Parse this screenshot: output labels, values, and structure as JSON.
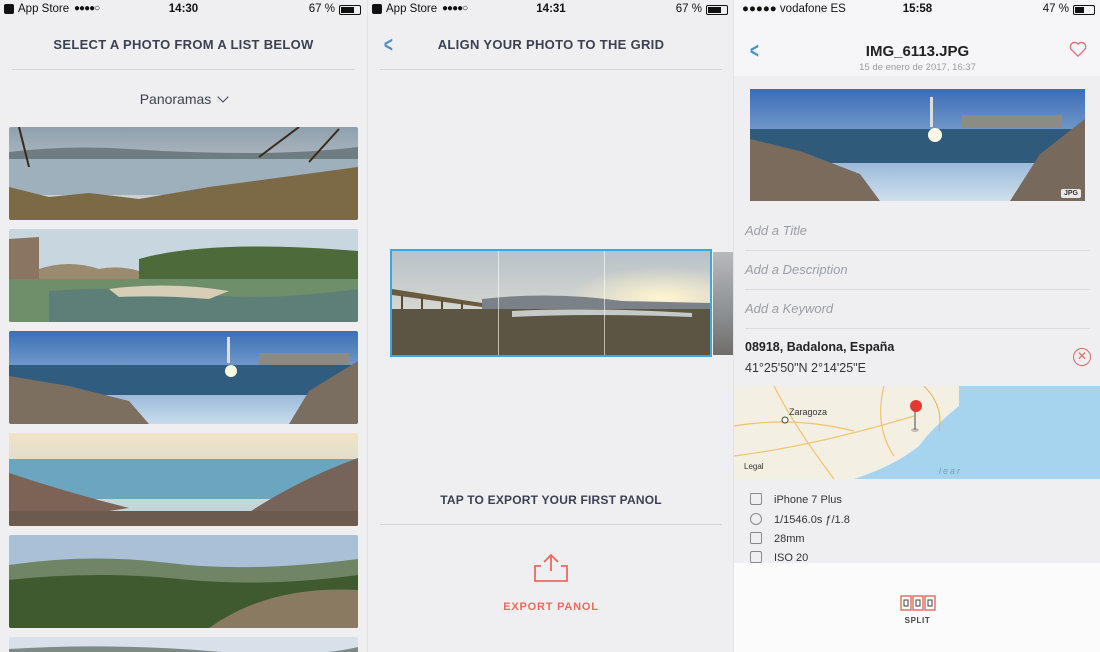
{
  "screen1": {
    "status": {
      "carrier": "App Store",
      "signal": "●●●●○",
      "time": "14:30",
      "battery": "67 %",
      "battery_level": 0.67
    },
    "title": "SELECT A PHOTO FROM A LIST BELOW",
    "album": "Panoramas"
  },
  "screen2": {
    "status": {
      "carrier": "App Store",
      "signal": "●●●●○",
      "time": "14:31",
      "battery": "67 %",
      "battery_level": 0.67
    },
    "title": "ALIGN YOUR PHOTO TO THE GRID",
    "tap_hint": "TAP TO EXPORT YOUR FIRST PANOL",
    "export_label": "EXPORT PANOL"
  },
  "screen3": {
    "status": {
      "carrier": "●●●●● vodafone ES",
      "time": "15:58",
      "battery": "47 %",
      "battery_level": 0.47
    },
    "filename": "IMG_6113.JPG",
    "date": "15 de enero de 2017, 16:37",
    "badge": "JPG",
    "title_placeholder": "Add a Title",
    "description_placeholder": "Add a Description",
    "keyword_placeholder": "Add a Keyword",
    "location": "08918, Badalona, España",
    "coordinates": "41°25'50\"N 2°14'25\"E",
    "map": {
      "city": "Zaragoza",
      "legal": "Legal",
      "sea": "lear"
    },
    "meta": [
      {
        "icon": "camera-icon",
        "text": "iPhone 7 Plus"
      },
      {
        "icon": "aperture-icon",
        "text": "1/1546.0s ƒ/1.8"
      },
      {
        "icon": "lens-icon",
        "text": "28mm"
      },
      {
        "icon": "iso-icon",
        "text": "ISO 20"
      }
    ],
    "split_label": "SPLIT"
  },
  "colors": {
    "accent_blue": "#3aa7e0",
    "accent_red": "#ea6b5c",
    "back_blue": "#4a90c8"
  }
}
